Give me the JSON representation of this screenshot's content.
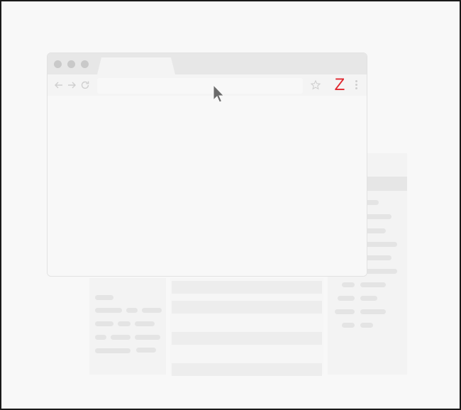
{
  "browser": {
    "toolbar": {
      "back_icon": "arrow-left-icon",
      "forward_icon": "arrow-right-icon",
      "reload_icon": "reload-icon",
      "bookmark_icon": "star-icon",
      "extension": {
        "icon": "z-extension-icon",
        "label": "Z",
        "color": "#e0282f"
      },
      "menu_icon": "kebab-menu-icon"
    },
    "window_controls": [
      "close-dot",
      "minimize-dot",
      "maximize-dot"
    ]
  },
  "cursor": {
    "icon": "mouse-pointer-icon",
    "color": "#6b6b6b"
  },
  "colors": {
    "frame_border": "#1a1a1a",
    "page_background": "#f8f8f8",
    "titlebar": "#e7e7e7",
    "placeholder_bar": "#e4e4e4"
  }
}
